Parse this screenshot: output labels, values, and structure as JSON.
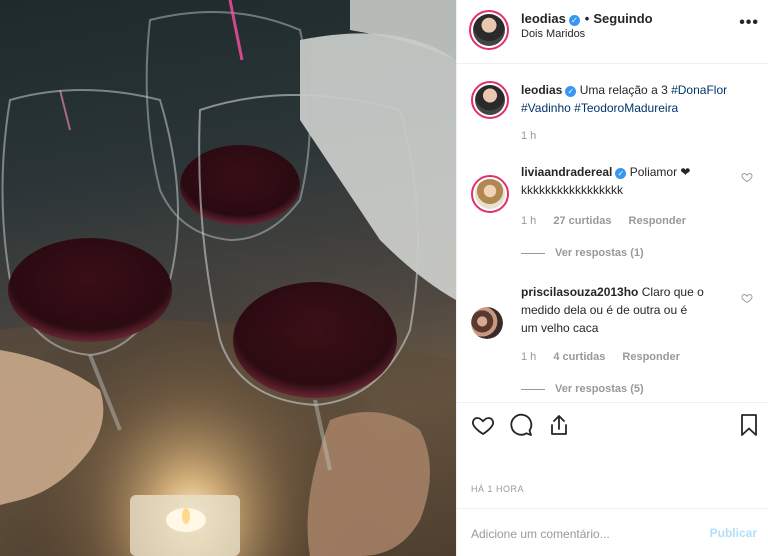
{
  "post": {
    "author": "leodias",
    "follow_separator": "•",
    "follow_status": "Seguindo",
    "location": "Dois Maridos",
    "more_icon": "more-icon",
    "caption": {
      "user": "leodias",
      "text": "Uma relação a 3",
      "hashtags": [
        "#DonaFlor",
        "#Vadinho",
        "#TeodoroMadureira"
      ],
      "time": "1 h"
    },
    "comments": [
      {
        "user": "liviaandradereal",
        "verified": true,
        "text_line1": "Poliamor ❤",
        "text_line2": "kkkkkkkkkkkkkkkkk",
        "time": "1 h",
        "likes": "27 curtidas",
        "reply": "Responder",
        "view_replies": "Ver respostas (1)"
      },
      {
        "user": "priscilasouza2013ho",
        "verified": false,
        "text_line1": "Claro que o",
        "text_line2": "medido dela ou é de outra ou é",
        "text_line3": "um velho caca",
        "time": "1 h",
        "likes": "4 curtidas",
        "reply": "Responder",
        "view_replies": "Ver respostas (5)"
      }
    ],
    "timestamp": "HÁ 1 HORA",
    "add_comment_placeholder": "Adicione um comentário...",
    "publish_label": "Publicar"
  },
  "colors": {
    "accent_blue": "#3897f0",
    "hashtag": "#003569",
    "muted": "#999999",
    "publish_disabled": "#b2dffc",
    "story_ring": "#e1306c"
  }
}
